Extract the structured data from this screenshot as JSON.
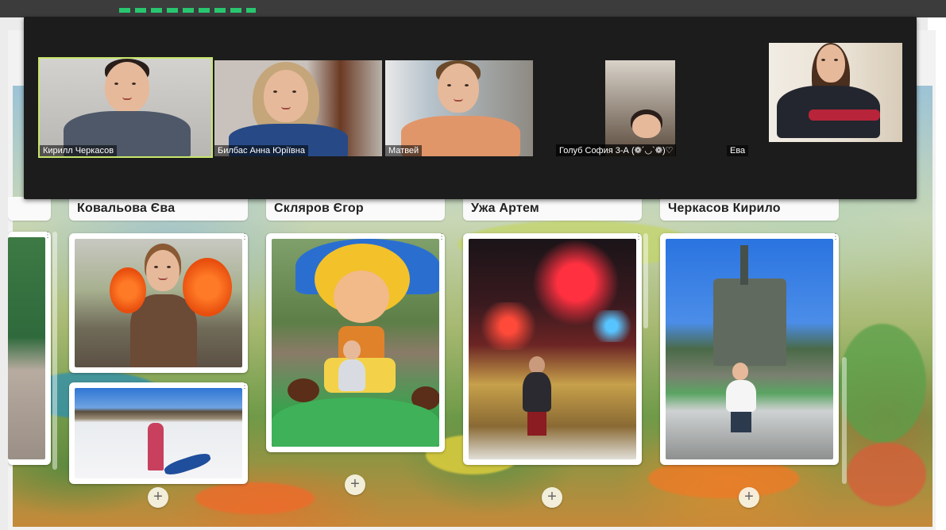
{
  "participants": [
    {
      "name": "Кирилл Черкасов",
      "active": true
    },
    {
      "name": "Билбас Анна Юріївна",
      "active": false
    },
    {
      "name": "Матвей",
      "active": false
    },
    {
      "name": "Голуб София 3-А (❁´◡`❁)♡",
      "active": false
    },
    {
      "name": "Ева",
      "active": false
    }
  ],
  "board": {
    "columns": [
      {
        "title": "Ковальова Єва"
      },
      {
        "title": "Скляров Єгор"
      },
      {
        "title": "Ужа Артем"
      },
      {
        "title": "Черкасов Кирило"
      }
    ],
    "add_icon": "plus-icon",
    "post_menu_icon": "more-vertical-icon"
  },
  "colors": {
    "active_speaker": "#c7e66b",
    "zoom_bg": "#1c1c1c",
    "top_bar_accent": "#28c76f"
  }
}
